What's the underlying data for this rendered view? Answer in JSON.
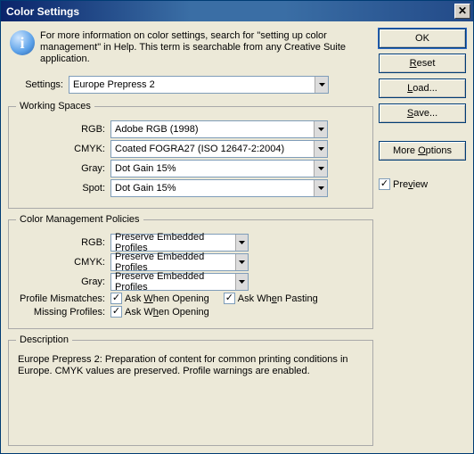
{
  "window": {
    "title": "Color Settings"
  },
  "info": "For more information on color settings, search for \"setting up color management\" in Help. This term is searchable from any Creative Suite application.",
  "settings": {
    "label": "Settings:",
    "value": "Europe Prepress 2"
  },
  "workingSpaces": {
    "legend": "Working Spaces",
    "rgb": {
      "label": "RGB:",
      "value": "Adobe RGB (1998)"
    },
    "cmyk": {
      "label": "CMYK:",
      "value": "Coated FOGRA27 (ISO 12647-2:2004)"
    },
    "gray": {
      "label": "Gray:",
      "value": "Dot Gain 15%"
    },
    "spot": {
      "label": "Spot:",
      "value": "Dot Gain 15%"
    }
  },
  "policies": {
    "legend": "Color Management Policies",
    "rgb": {
      "label": "RGB:",
      "value": "Preserve Embedded Profiles"
    },
    "cmyk": {
      "label": "CMYK:",
      "value": "Preserve Embedded Profiles"
    },
    "gray": {
      "label": "Gray:",
      "value": "Preserve Embedded Profiles"
    },
    "mismatch": {
      "label": "Profile Mismatches:",
      "opening": "Ask When Opening",
      "pasting": "Ask When Pasting"
    },
    "missing": {
      "label": "Missing Profiles:",
      "opening": "Ask When Opening"
    }
  },
  "description": {
    "legend": "Description",
    "text": "Europe Prepress 2:   Preparation of content for common printing conditions in Europe. CMYK values are preserved. Profile warnings are enabled."
  },
  "buttons": {
    "ok": "OK",
    "reset": "Reset",
    "load": "Load...",
    "save": "Save...",
    "moreOptions": "More Options",
    "preview": "Preview"
  }
}
